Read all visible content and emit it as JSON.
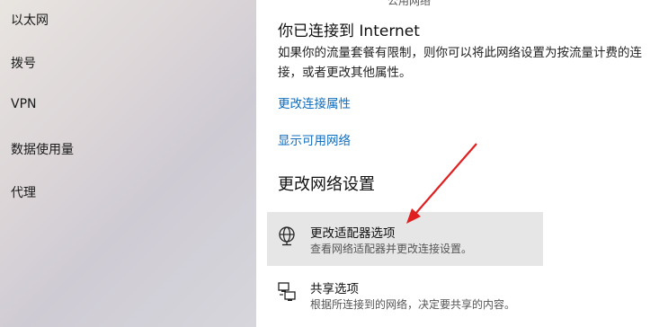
{
  "sidebar": {
    "items": [
      {
        "label": "以太网"
      },
      {
        "label": "拨号"
      },
      {
        "label": "VPN"
      },
      {
        "label": "数据使用量"
      },
      {
        "label": "代理"
      }
    ]
  },
  "main": {
    "top_cut_text": "公用网络",
    "status_title": "你已连接到 Internet",
    "status_desc": "如果你的流量套餐有限制，则你可以将此网络设置为按流量计费的连接，或者更改其他属性。",
    "link_properties": "更改连接属性",
    "link_available": "显示可用网络",
    "section_title": "更改网络设置",
    "options": [
      {
        "title": "更改适配器选项",
        "desc": "查看网络适配器并更改连接设置。",
        "icon": "network-adapter-icon"
      },
      {
        "title": "共享选项",
        "desc": "根据所连接到的网络，决定要共享的内容。",
        "icon": "sharing-icon"
      }
    ]
  },
  "colors": {
    "link": "#0f6cbd",
    "highlight": "#e6e6e6",
    "annotation_arrow": "#e02020"
  }
}
